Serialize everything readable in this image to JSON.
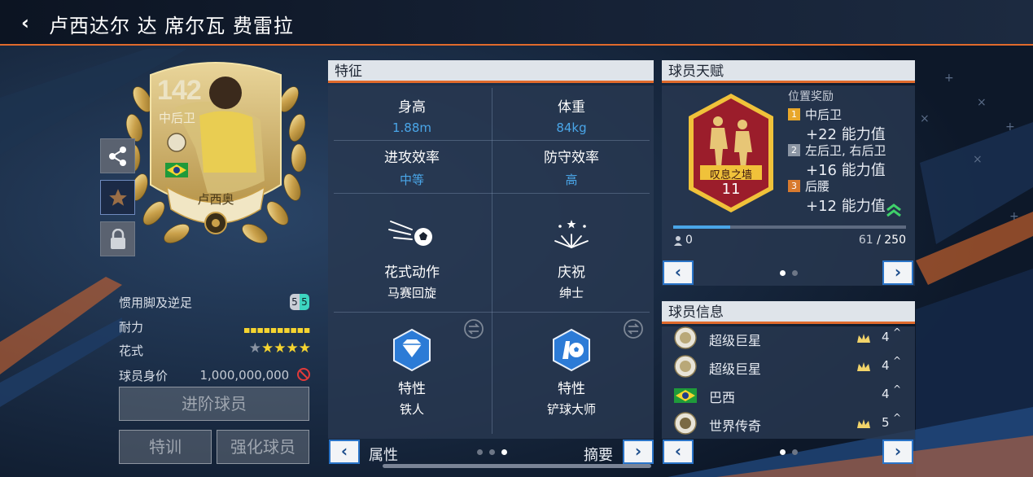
{
  "header": {
    "back_label": "‹",
    "title": "卢西达尔 达 席尔瓦 费雷拉"
  },
  "card": {
    "ovr": "142",
    "position": "中后卫",
    "name": "卢西奥"
  },
  "left_stats": {
    "footedness": {
      "label": "惯用脚及逆足",
      "left_foot": "5",
      "right_foot": "5"
    },
    "stamina": {
      "label": "耐力",
      "segments": 10
    },
    "skill_moves": {
      "label": "花式",
      "stars": 4,
      "max_stars": 5
    },
    "value": {
      "label": "球员身价",
      "amount": "1,000,000,000"
    }
  },
  "buttons": {
    "advance": "进阶球员",
    "training": "特训",
    "enhance": "强化球员"
  },
  "traits_panel": {
    "title": "特征",
    "height_label": "身高",
    "height_value": "1.88m",
    "weight_label": "体重",
    "weight_value": "84kg",
    "attack_label": "进攻效率",
    "attack_value": "中等",
    "defense_label": "防守效率",
    "defense_value": "高",
    "skill_label": "花式动作",
    "skill_value": "马赛回旋",
    "celebration_label": "庆祝",
    "celebration_value": "绅士",
    "trait1_label": "特性",
    "trait1_value": "铁人",
    "trait2_label": "特性",
    "trait2_value": "铲球大师",
    "footer_left": "属性",
    "footer_right": "摘要",
    "page": 3,
    "pages": 3
  },
  "talent_panel": {
    "title": "球员天赋",
    "badge_name": "叹息之墙",
    "badge_level": "11",
    "bonus_title": "位置奖励",
    "bonuses": [
      {
        "rank": "1",
        "positions": "中后卫",
        "value": "+22 能力值",
        "color": "#e8a72a"
      },
      {
        "rank": "2",
        "positions": "左后卫, 右后卫",
        "value": "+16 能力值",
        "color": "#8c96a4"
      },
      {
        "rank": "3",
        "positions": "后腰",
        "value": "+12 能力值",
        "color": "#d87a2e"
      }
    ],
    "progress_left": "0",
    "progress_current": "61",
    "progress_total": "/ 250",
    "progress_fraction": 0.244,
    "page": 1,
    "pages": 2
  },
  "info_panel": {
    "title": "球员信息",
    "rows": [
      {
        "name": "超级巨星",
        "count": "4"
      },
      {
        "name": "超级巨星",
        "count": "4"
      },
      {
        "name": "巴西",
        "count": "4"
      },
      {
        "name": "世界传奇",
        "count": "5"
      }
    ],
    "page": 1,
    "pages": 2
  },
  "colors": {
    "accent": "#e06a2c",
    "value_blue": "#4aa6e8",
    "gold": "#f5d430",
    "nav_border": "#2a74c8"
  }
}
